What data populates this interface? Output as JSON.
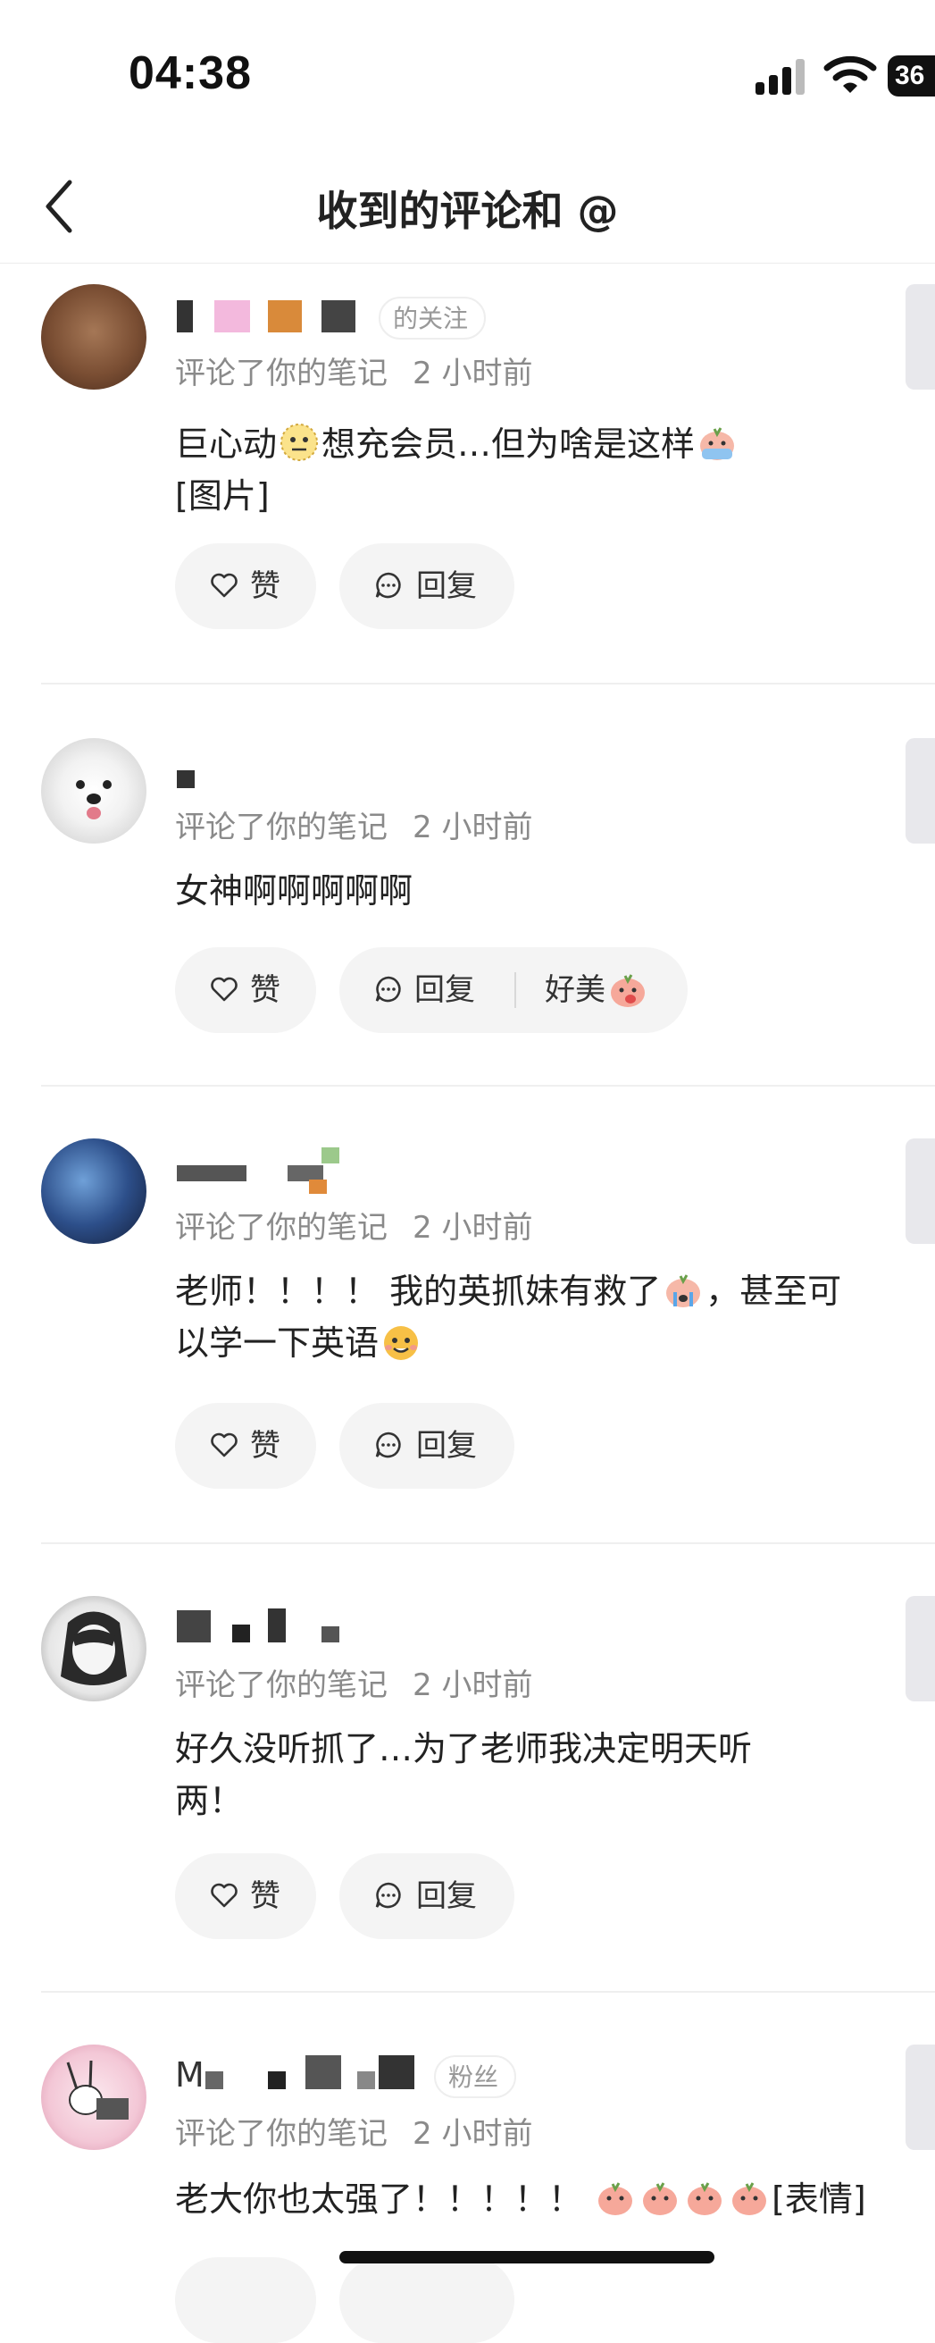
{
  "status_bar": {
    "time": "04:38",
    "battery": "36"
  },
  "nav": {
    "title": "收到的评论和 @"
  },
  "common": {
    "meta_action": "评论了你的笔记",
    "like": "赞",
    "reply": "回复"
  },
  "comments": [
    {
      "tag": "的关注",
      "time": "2 小时前",
      "text": [
        "巨心动",
        "想充会员…但为啥是这样",
        "[图片]"
      ]
    },
    {
      "time": "2 小时前",
      "text": [
        "女神啊啊啊啊啊"
      ],
      "quick_reply": "好美"
    },
    {
      "time": "2 小时前",
      "text": [
        "老师！！！！ 我的英抓妹有救了",
        "，甚至可以学一下英语"
      ]
    },
    {
      "time": "2 小时前",
      "text": [
        "好久没听抓了…为了老师我决定明天听两！"
      ]
    },
    {
      "name_initial": "M",
      "tag": "粉丝",
      "time": "2 小时前",
      "text": [
        "老大你也太强了！！！！！ ",
        "[表情]"
      ]
    }
  ],
  "colors": {
    "accent_gray": "#f4f4f4",
    "text_dark": "#222222",
    "text_meta": "#8a8a8a"
  }
}
